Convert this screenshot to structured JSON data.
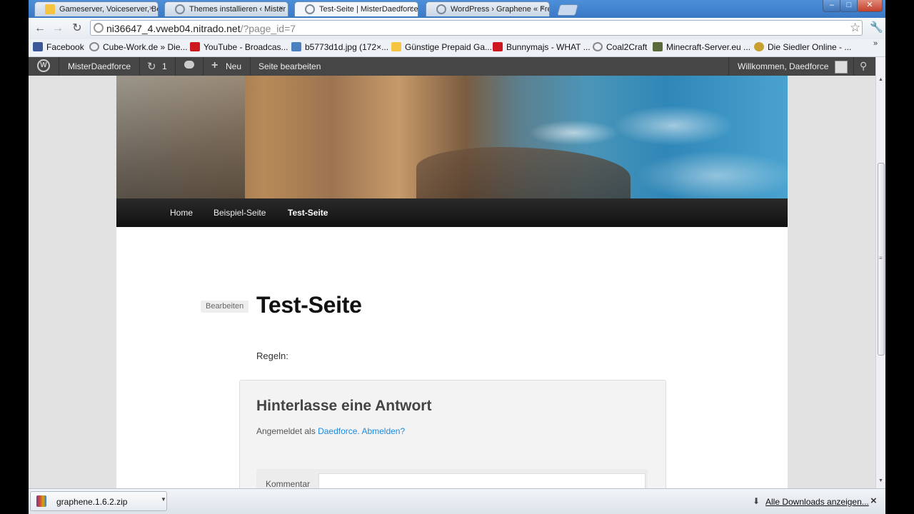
{
  "tabs": [
    {
      "title": "Gameserver, Voiceserver, Be",
      "icon": "folder-icon",
      "color": "#f5c542"
    },
    {
      "title": "Themes installieren ‹ Mister",
      "icon": "globe-icon",
      "color": "#7a8a9a"
    },
    {
      "title": "Test-Seite | MisterDaedforce",
      "icon": "globe-icon",
      "color": "#7a8a9a"
    },
    {
      "title": "WordPress › Graphene « Fre",
      "icon": "wordpress-icon",
      "color": "#7a8a9a"
    }
  ],
  "tab_close": "×",
  "address": {
    "host": "ni36647_4.vweb04.nitrado.net",
    "path": "/?page_id=7"
  },
  "bookmarks": [
    {
      "label": "Facebook",
      "color": "#3b5998"
    },
    {
      "label": "Cube-Work.de » Die...",
      "color": "#888888"
    },
    {
      "label": "YouTube - Broadcas...",
      "color": "#cc181e"
    },
    {
      "label": "b5773d1d.jpg (172×...",
      "color": "#4a7fc0"
    },
    {
      "label": "Günstige Prepaid Ga...",
      "color": "#f5c542"
    },
    {
      "label": "Bunnymajs - WHAT ...",
      "color": "#cc181e"
    },
    {
      "label": "Coal2Craft",
      "color": "#888888"
    },
    {
      "label": "Minecraft-Server.eu ...",
      "color": "#5a6a3a"
    },
    {
      "label": "Die Siedler Online - ...",
      "color": "#c8a030"
    }
  ],
  "bookmarks_more": "»",
  "adminbar": {
    "site_name": "MisterDaedforce",
    "updates_count": "1",
    "new_label": "Neu",
    "edit_page_label": "Seite bearbeiten",
    "welcome": "Willkommen, Daedforce"
  },
  "site_menu": [
    "Home",
    "Beispiel-Seite",
    "Test-Seite"
  ],
  "page": {
    "edit_label": "Bearbeiten",
    "title": "Test-Seite",
    "content": "Regeln:"
  },
  "comments": {
    "reply_title": "Hinterlasse eine Antwort",
    "logged_in_prefix": "Angemeldet als",
    "user_link": "Daedforce.",
    "logout_link": "Abmelden?",
    "comment_label": "Kommentar"
  },
  "downloads": {
    "file_name": "graphene.1.6.2.zip",
    "show_all": "Alle Downloads anzeigen...",
    "close": "×"
  }
}
